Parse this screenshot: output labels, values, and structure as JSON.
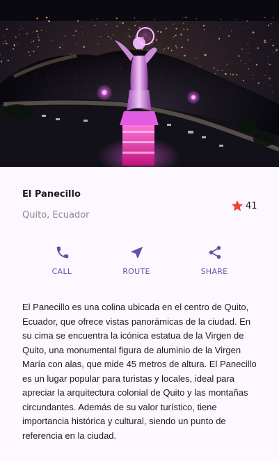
{
  "hero": {
    "image_description": "Aerial night photo of the illuminated Virgen de Quito statue atop El Panecillo with city lights",
    "colors": {
      "sky": "#14121e",
      "city_glow": "#ffb347",
      "statue_light": "#e36be8",
      "base_light": "#ff3fae"
    }
  },
  "place": {
    "title": "El Panecillo",
    "subtitle": "Quito, Ecuador"
  },
  "rating": {
    "icon": "star-icon",
    "color": "#f44336",
    "count": "41"
  },
  "actions": [
    {
      "label": "CALL",
      "icon": "phone-icon"
    },
    {
      "label": "ROUTE",
      "icon": "navigation-icon"
    },
    {
      "label": "SHARE",
      "icon": "share-icon"
    }
  ],
  "accent_color": "#6750a4",
  "description": "El Panecillo es una colina ubicada en el centro de Quito, Ecuador, que ofrece vistas panorámicas de la ciudad. En su cima se encuentra la icónica estatua de la Virgen de Quito, una monumental figura de aluminio de la Virgen María con alas, que mide 45 metros de altura. El Panecillo es un lugar popular para turistas y locales, ideal para apreciar la arquitectura colonial de Quito y las montañas circundantes. Además de su valor turístico, tiene importancia histórica y cultural, siendo un punto de referencia en la ciudad."
}
